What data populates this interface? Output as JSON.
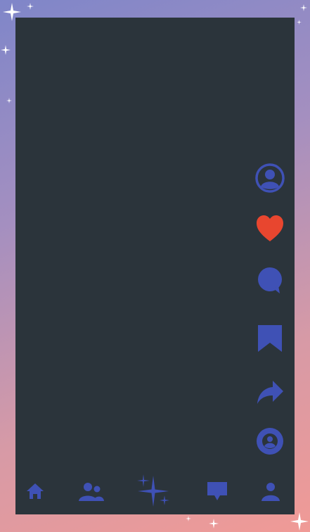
{
  "colors": {
    "background_gradient": [
      "#7f86c9",
      "#a48fc0",
      "#d79aa6",
      "#f09a96"
    ],
    "screen": "#2b343b",
    "icon": "#3f51b5",
    "like": "#e8462f",
    "sparkle": "#ffffff"
  },
  "side_actions": [
    {
      "name": "profile-avatar-icon",
      "icon": "account-circle"
    },
    {
      "name": "like-heart-icon",
      "icon": "heart"
    },
    {
      "name": "comment-bubble-icon",
      "icon": "chat-bubble"
    },
    {
      "name": "bookmark-icon",
      "icon": "bookmark"
    },
    {
      "name": "share-icon",
      "icon": "share-arrow"
    },
    {
      "name": "creator-avatar-icon",
      "icon": "account-circle-filled"
    }
  ],
  "bottom_nav": [
    {
      "name": "home-icon",
      "icon": "home"
    },
    {
      "name": "friends-icon",
      "icon": "people"
    },
    {
      "name": "create-sparkle-icon",
      "icon": "sparkle"
    },
    {
      "name": "inbox-icon",
      "icon": "message"
    },
    {
      "name": "profile-icon",
      "icon": "person"
    }
  ]
}
